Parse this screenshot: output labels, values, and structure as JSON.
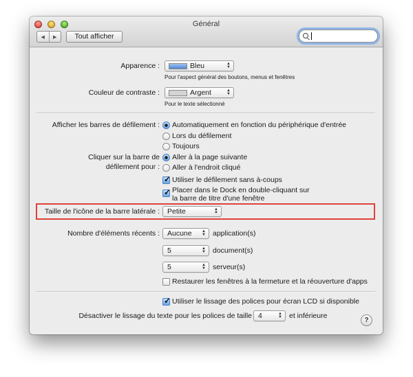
{
  "window": {
    "title": "Général"
  },
  "toolbar": {
    "back_label": "◀",
    "forward_label": "▶",
    "show_all_label": "Tout afficher",
    "search_value": ""
  },
  "appearance": {
    "label": "Apparence :",
    "value": "Bleu",
    "swatch_color": "#6f9fdf",
    "help": "Pour l'aspect général des boutons, menus et fenêtres"
  },
  "highlight": {
    "label": "Couleur de contraste :",
    "value": "Argent",
    "swatch_color": "#d4d4d4",
    "help": "Pour le texte sélectionné"
  },
  "scrollbars": {
    "label": "Afficher les barres de défilement :",
    "options": [
      "Automatiquement en fonction du périphérique d'entrée",
      "Lors du défilement",
      "Toujours"
    ],
    "selected": 0
  },
  "click_scroll": {
    "label_line1": "Cliquer sur la barre de",
    "label_line2": "défilement pour :",
    "options": [
      "Aller à la page suivante",
      "Aller à l'endroit cliqué"
    ],
    "selected": 0
  },
  "smooth_scroll": {
    "label": "Utiliser le défilement sans à-coups",
    "checked": true
  },
  "dock_dblclick": {
    "label_line1": "Placer dans le Dock en double-cliquant sur",
    "label_line2": "la barre de titre d'une fenêtre",
    "checked": true
  },
  "sidebar_icon": {
    "label": "Taille de l'icône de la barre latérale :",
    "value": "Petite",
    "highlight_color": "#e0413a"
  },
  "recent": {
    "label": "Nombre d'éléments récents :",
    "apps_value": "Aucune",
    "apps_unit": "application(s)",
    "docs_value": "5",
    "docs_unit": "document(s)",
    "servers_value": "5",
    "servers_unit": "serveur(s)"
  },
  "restore_windows": {
    "label": "Restaurer les fenêtres à la fermeture et la réouverture d'apps",
    "checked": false
  },
  "lcd_smoothing": {
    "label": "Utiliser le lissage des polices pour écran LCD si disponible",
    "checked": true
  },
  "font_smoothing": {
    "label_before": "Désactiver le lissage du texte pour les polices de taille",
    "value": "4",
    "label_after": "et inférieure"
  },
  "help_button": {
    "label": "?"
  }
}
